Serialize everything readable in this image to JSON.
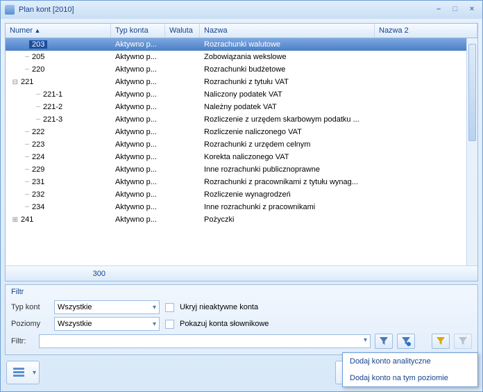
{
  "window": {
    "title": "Plan kont [2010]"
  },
  "grid": {
    "headers": {
      "numer": "Numer",
      "typ": "Typ konta",
      "waluta": "Waluta",
      "nazwa": "Nazwa",
      "nazwa2": "Nazwa 2"
    },
    "rows": [
      {
        "indent": 1,
        "expander": "",
        "num": "203",
        "typ": "Aktywno p...",
        "wal": "",
        "naz": "Rozrachunki walutowe",
        "sel": true
      },
      {
        "indent": 1,
        "expander": "",
        "num": "205",
        "typ": "Aktywno p...",
        "wal": "",
        "naz": "Zobowiązania wekslowe"
      },
      {
        "indent": 1,
        "expander": "",
        "num": "220",
        "typ": "Aktywno p...",
        "wal": "",
        "naz": "Rozrachunki budżetowe"
      },
      {
        "indent": 0,
        "expander": "⊟",
        "num": "221",
        "typ": "Aktywno p...",
        "wal": "",
        "naz": "Rozrachunki z tytułu VAT"
      },
      {
        "indent": 2,
        "expander": "",
        "num": "221-1",
        "typ": "Aktywno p...",
        "wal": "",
        "naz": "Naliczony podatek VAT"
      },
      {
        "indent": 2,
        "expander": "",
        "num": "221-2",
        "typ": "Aktywno p...",
        "wal": "",
        "naz": "Należny podatek VAT"
      },
      {
        "indent": 2,
        "expander": "",
        "num": "221-3",
        "typ": "Aktywno p...",
        "wal": "",
        "naz": "Rozliczenie z urzędem skarbowym podatku ..."
      },
      {
        "indent": 1,
        "expander": "",
        "num": "222",
        "typ": "Aktywno p...",
        "wal": "",
        "naz": "Rozliczenie naliczonego VAT"
      },
      {
        "indent": 1,
        "expander": "",
        "num": "223",
        "typ": "Aktywno p...",
        "wal": "",
        "naz": "Rozrachunki z urzędem celnym"
      },
      {
        "indent": 1,
        "expander": "",
        "num": "224",
        "typ": "Aktywno p...",
        "wal": "",
        "naz": "Korekta naliczonego VAT"
      },
      {
        "indent": 1,
        "expander": "",
        "num": "229",
        "typ": "Aktywno p...",
        "wal": "",
        "naz": "Inne rozrachunki publicznoprawne"
      },
      {
        "indent": 1,
        "expander": "",
        "num": "231",
        "typ": "Aktywno p...",
        "wal": "",
        "naz": "Rozrachunki z pracownikami z tytułu wynag..."
      },
      {
        "indent": 1,
        "expander": "",
        "num": "232",
        "typ": "Aktywno p...",
        "wal": "",
        "naz": "Rozliczenie wynagrodzeń"
      },
      {
        "indent": 1,
        "expander": "",
        "num": "234",
        "typ": "Aktywno p...",
        "wal": "",
        "naz": "Inne rozrachunki z pracownikami"
      },
      {
        "indent": 0,
        "expander": "⊞",
        "num": "241",
        "typ": "Aktywno p...",
        "wal": "",
        "naz": "Pożyczki"
      }
    ],
    "footer_sum": "300"
  },
  "filter": {
    "panel_title": "Filtr",
    "typ_label": "Typ kont",
    "typ_value": "Wszystkie",
    "poziomy_label": "Poziomy",
    "poziomy_value": "Wszystkie",
    "hide_inactive": "Ukryj nieaktywne konta",
    "show_dict": "Pokazuj konta słownikowe",
    "filtr_label": "Filtr:"
  },
  "popup": {
    "item1": "Dodaj konto analityczne",
    "item2": "Dodaj konto na tym poziomie"
  }
}
